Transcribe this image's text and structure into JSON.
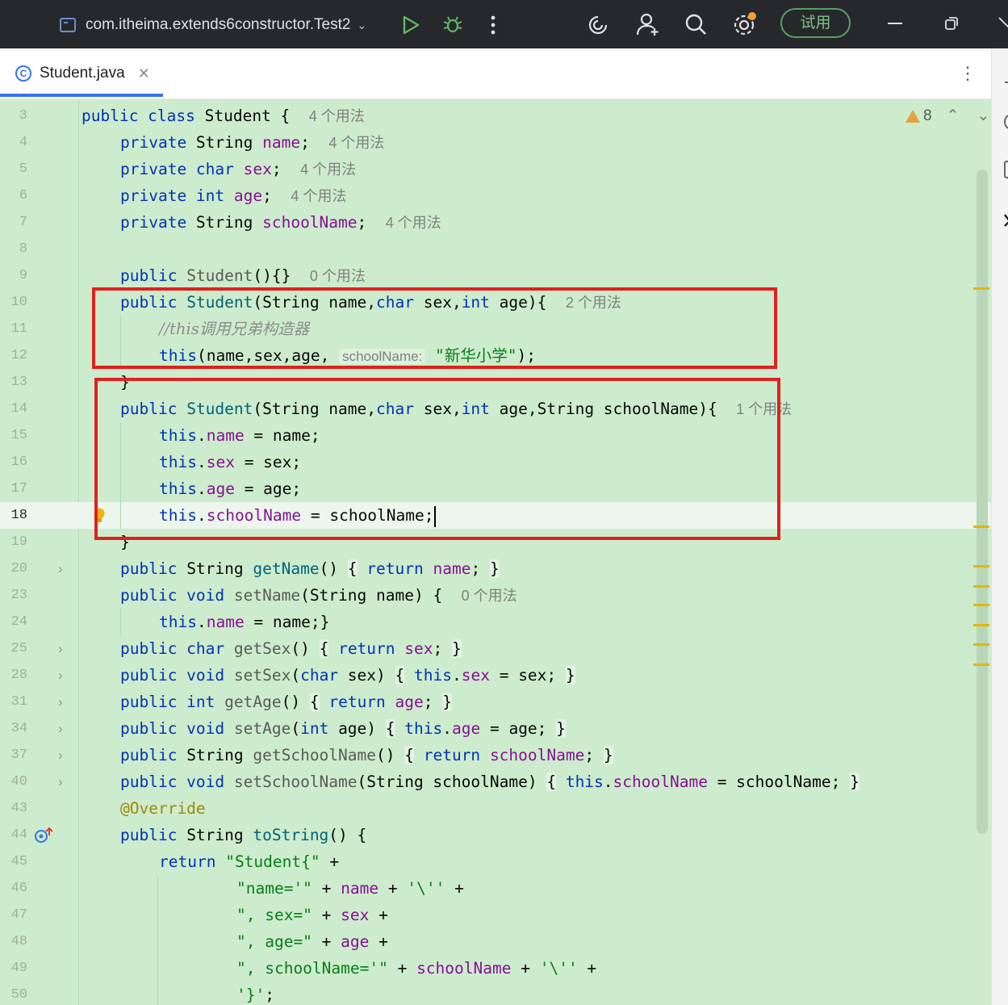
{
  "titlebar": {
    "run_config": "com.itheima.extends6constructor.Test2",
    "trial_label": "试用"
  },
  "tab": {
    "filename": "Student.java",
    "class_icon_letter": "C"
  },
  "problems": {
    "warning_count": "8"
  },
  "code_lines": [
    {
      "ln": "3"
    },
    {
      "ln": "4"
    },
    {
      "ln": "5"
    },
    {
      "ln": "6"
    },
    {
      "ln": "7"
    },
    {
      "ln": "8"
    },
    {
      "ln": "9"
    },
    {
      "ln": "10"
    },
    {
      "ln": "11"
    },
    {
      "ln": "12"
    },
    {
      "ln": "13"
    },
    {
      "ln": "14"
    },
    {
      "ln": "15"
    },
    {
      "ln": "16"
    },
    {
      "ln": "17"
    },
    {
      "ln": "18"
    },
    {
      "ln": "19"
    },
    {
      "ln": "20"
    },
    {
      "ln": "23"
    },
    {
      "ln": "24"
    },
    {
      "ln": "25"
    },
    {
      "ln": "28"
    },
    {
      "ln": "31"
    },
    {
      "ln": "34"
    },
    {
      "ln": "37"
    },
    {
      "ln": "40"
    },
    {
      "ln": "43"
    },
    {
      "ln": "44"
    },
    {
      "ln": "45"
    },
    {
      "ln": "46"
    },
    {
      "ln": "47"
    },
    {
      "ln": "48"
    },
    {
      "ln": "49"
    },
    {
      "ln": "50"
    }
  ],
  "hints": {
    "u4": "4 个用法",
    "u0": "0 个用法",
    "u2": "2 个用法",
    "u1": "1 个用法"
  },
  "comment_line11": "//this调用兄弟构造器",
  "inlay_param": "schoolName:",
  "string_school": "\"新华小学\"",
  "colors": {
    "keyword": "#0033b3",
    "field": "#871094",
    "string": "#067d17",
    "highlight_box": "#e02020",
    "editor_bg": "#cdeccd"
  }
}
